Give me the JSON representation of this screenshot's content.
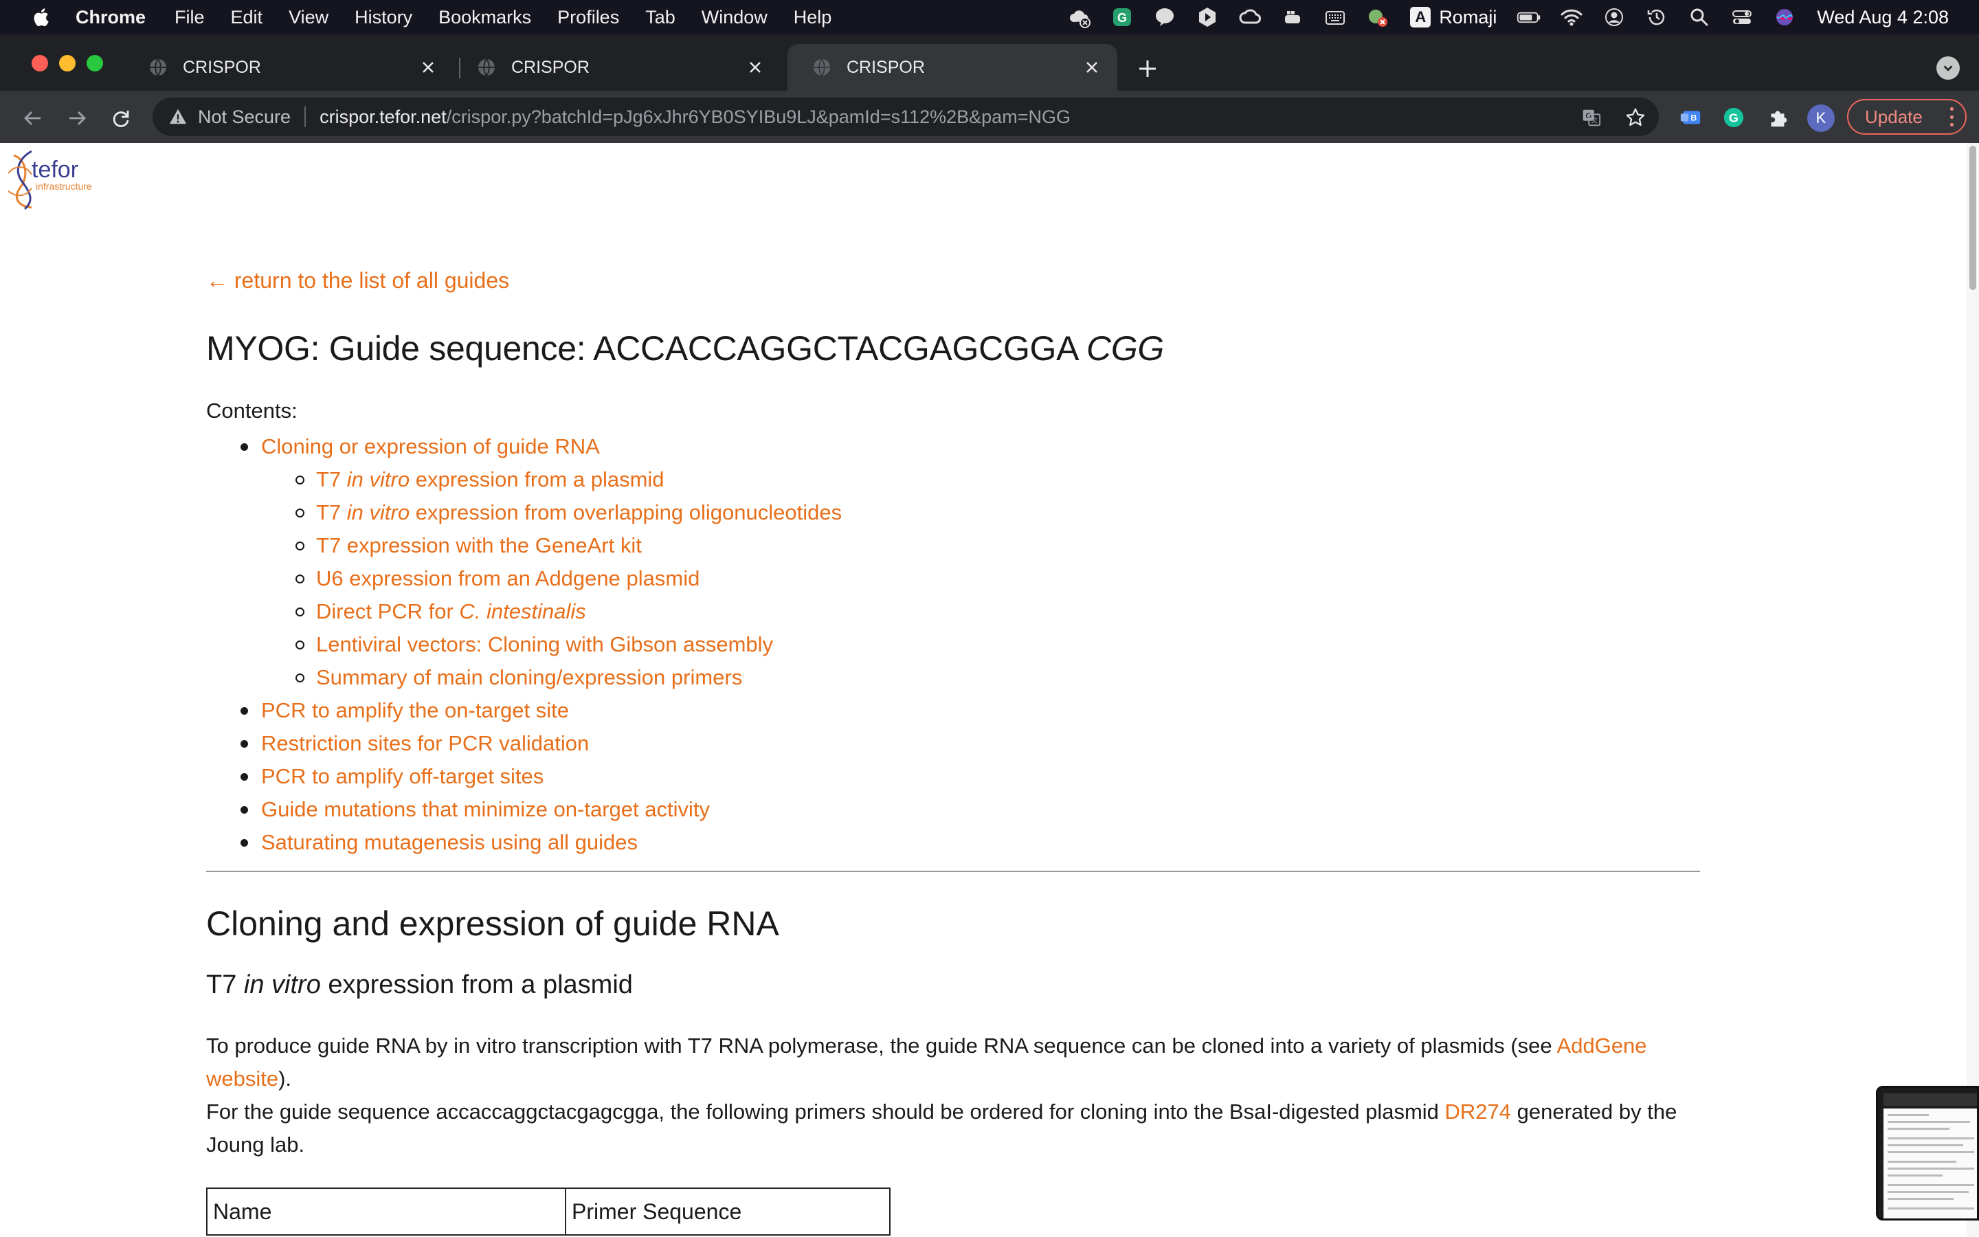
{
  "menubar": {
    "app_name": "Chrome",
    "items": [
      "File",
      "Edit",
      "View",
      "History",
      "Bookmarks",
      "Profiles",
      "Tab",
      "Window",
      "Help"
    ],
    "input_method": "Romaji",
    "input_method_glyph": "A",
    "clock": "Wed Aug 4  2:08",
    "status_icons": [
      "cloud-off-icon",
      "g-app-icon",
      "line-app-icon",
      "play-app-icon",
      "creative-cloud-icon",
      "docker-icon",
      "keyboard-icon",
      "colorsync-icon",
      "input-method-icon",
      "battery-icon",
      "wifi-icon",
      "user-icon",
      "time-machine-icon",
      "spotlight-icon",
      "control-center-icon",
      "siri-icon"
    ]
  },
  "browser": {
    "tabs": [
      {
        "title": "CRISPOR",
        "active": false
      },
      {
        "title": "CRISPOR",
        "active": false
      },
      {
        "title": "CRISPOR",
        "active": true
      }
    ],
    "security_label": "Not Secure",
    "url_host": "crispor.tefor.net",
    "url_path": "/crispor.py?batchId=pJg6xJhr6YB0SYIBu9LJ&pamId=s112%2B&pam=NGG",
    "profile_initial": "K",
    "update_label": "Update"
  },
  "page": {
    "logo_text": "tefor",
    "logo_subtext": "infrastructure",
    "back_link": "← return to the list of all guides",
    "title_prefix": "MYOG: Guide sequence: ACCACCAGGCTACGAGCGGA ",
    "title_pam": "CGG",
    "contents_label": "Contents:",
    "toc": {
      "cloning": "Cloning or expression of guide RNA",
      "sub": {
        "t7_plasmid_pre": "T7 ",
        "t7_plasmid_em": "in vitro",
        "t7_plasmid_post": " expression from a plasmid",
        "t7_oligo_pre": "T7 ",
        "t7_oligo_em": "in vitro",
        "t7_oligo_post": " expression from overlapping oligonucleotides",
        "geneart": "T7 expression with the GeneArt kit",
        "u6": "U6 expression from an Addgene plasmid",
        "direct_pcr_pre": "Direct PCR for ",
        "direct_pcr_em": "C. intestinalis",
        "lentiviral": "Lentiviral vectors: Cloning with Gibson assembly",
        "summary": "Summary of main cloning/expression primers"
      },
      "pcr_on_target": "PCR to amplify the on-target site",
      "restriction": "Restriction sites for PCR validation",
      "pcr_off_target": "PCR to amplify off-target sites",
      "mutations": "Guide mutations that minimize on-target activity",
      "saturating": "Saturating mutagenesis using all guides"
    },
    "section_title": "Cloning and expression of guide RNA",
    "subsection_pre": "T7 ",
    "subsection_em": "in vitro",
    "subsection_post": " expression from a plasmid",
    "para1_pre": "To produce guide RNA by in vitro transcription with T7 RNA polymerase, the guide RNA sequence can be cloned into a variety of plasmids (see ",
    "para1_link": "AddGene website",
    "para1_post": ").",
    "para2_pre": "For the guide sequence accaccaggctacgagcgga, the following primers should be ordered for cloning into the BsaI-digested plasmid ",
    "para2_link": "DR274",
    "para2_post": " generated by the Joung lab.",
    "table_headers": [
      "Name",
      "Primer Sequence"
    ]
  },
  "colors": {
    "link": "#e86f1a",
    "menubar_bg": "#15151f",
    "tabstrip_bg": "#202124",
    "toolbar_bg": "#35363a"
  }
}
